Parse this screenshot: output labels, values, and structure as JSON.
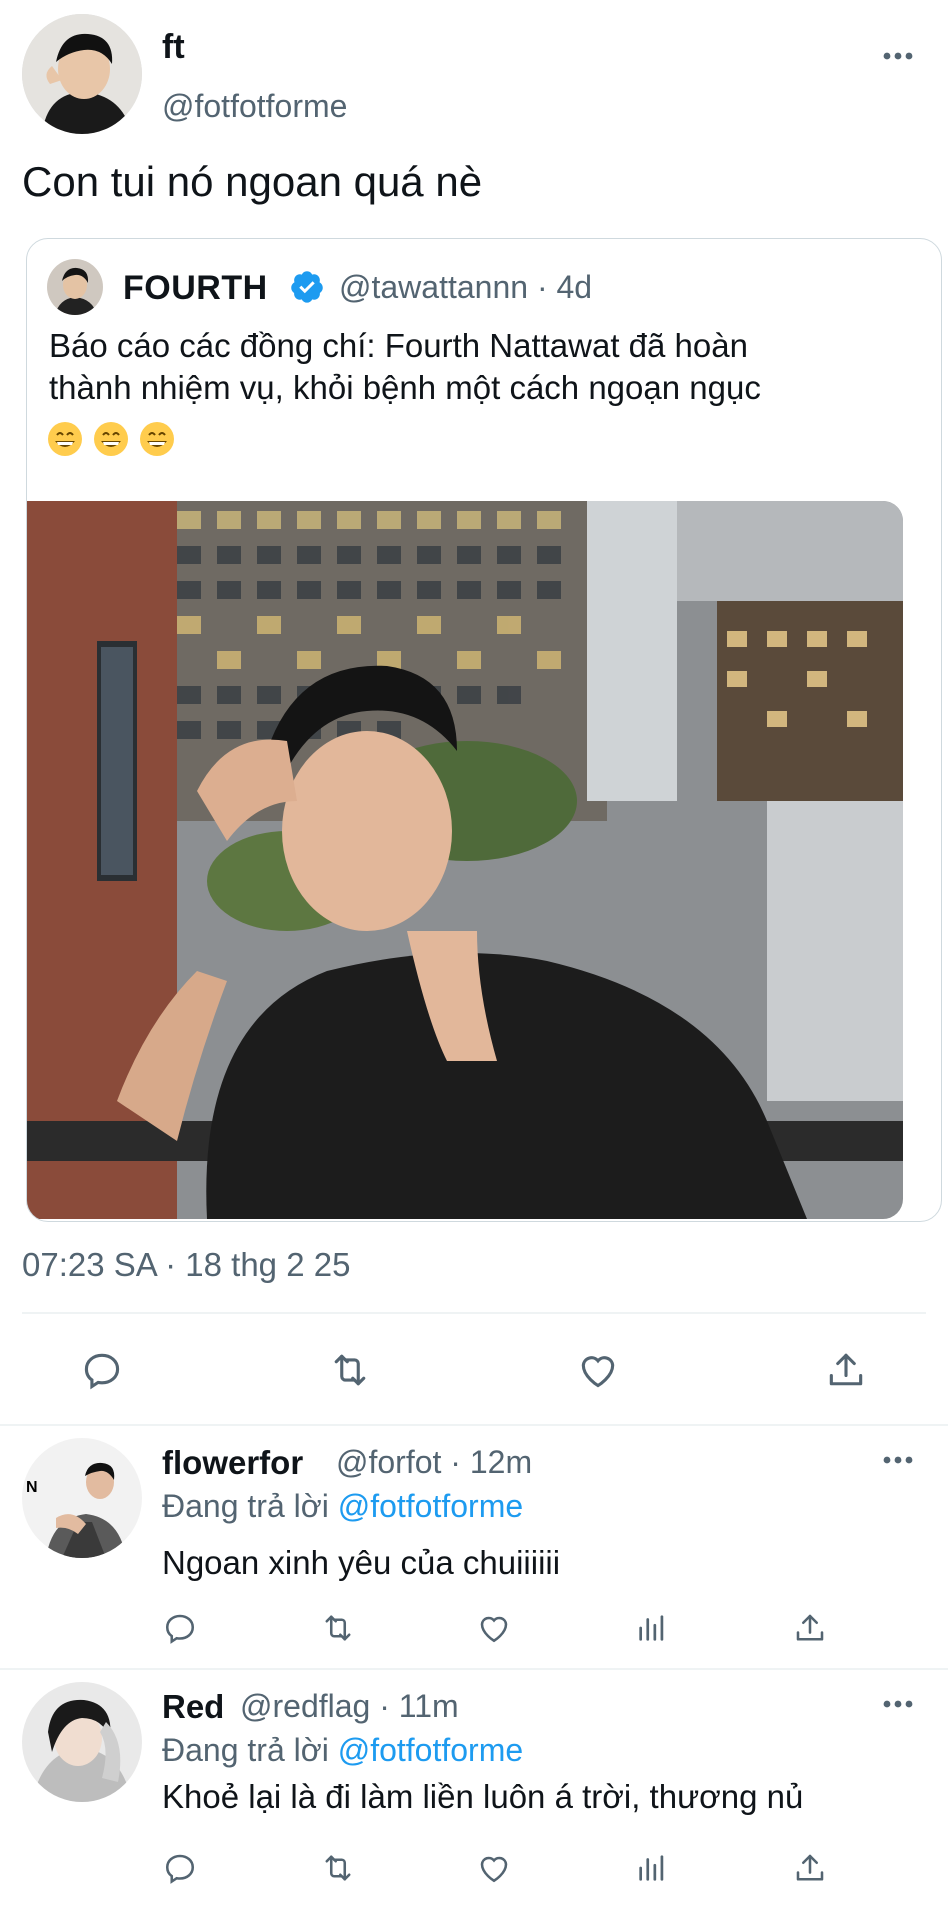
{
  "tweet": {
    "author_name": "ft",
    "author_handle": "@fotfotforme",
    "text": "Con tui nó ngoan quá nè",
    "timestamp": "07:23 SA · 18 thg 2 25"
  },
  "quoted": {
    "name": "FOURTH",
    "handle_time": "@tawattannn · 4d",
    "text_line1": "Báo cáo các đồng chí: Fourth Nattawat đã hoàn",
    "text_line2": "thành nhiệm vụ, khỏi bệnh một cách ngoạn ngục",
    "emojis": [
      "😁",
      "😁",
      "😁"
    ],
    "verified_color": "#1d9bf0"
  },
  "replies": [
    {
      "name": "flowerfor",
      "handle_time": "@forfot · 12m",
      "replying_prefix": "Đang trả lời",
      "replying_to": "@fotfotforme",
      "text": "Ngoan xinh yêu của chuiiiiii"
    },
    {
      "name": "Red",
      "handle_time": "@redflag · 11m",
      "replying_prefix": "Đang trả lời",
      "replying_to": "@fotfotforme",
      "text": "Khoẻ lại là đi làm liền luôn á trời, thương nủ"
    }
  ],
  "colors": {
    "accent": "#1d9bf0",
    "text": "#0f1419",
    "muted": "#536471",
    "divider": "#eff3f4"
  },
  "icons": [
    "more-icon",
    "reply-icon",
    "retweet-icon",
    "like-icon",
    "share-icon",
    "views-icon",
    "verified-badge-icon"
  ]
}
